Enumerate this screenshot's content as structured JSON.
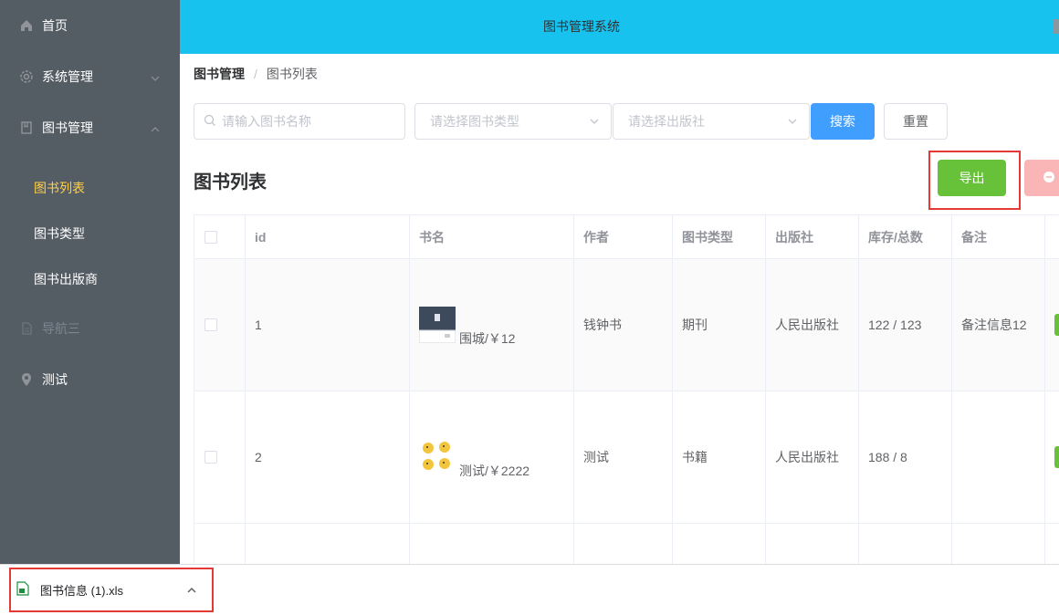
{
  "sidebar": {
    "home": "首页",
    "system": "系统管理",
    "books": "图书管理",
    "submenu": [
      "图书列表",
      "图书类型",
      "图书出版商"
    ],
    "nav3": "导航三",
    "test": "测试"
  },
  "header": {
    "title": "图书管理系统"
  },
  "breadcrumb": {
    "parent": "图书管理",
    "separator": "/",
    "current": "图书列表"
  },
  "filters": {
    "name_placeholder": "请输入图书名称",
    "type_placeholder": "请选择图书类型",
    "publisher_placeholder": "请选择出版社",
    "search_label": "搜索",
    "reset_label": "重置"
  },
  "section": {
    "title": "图书列表",
    "export_label": "导出"
  },
  "table": {
    "headers": [
      "id",
      "书名",
      "作者",
      "图书类型",
      "出版社",
      "库存/总数",
      "备注"
    ],
    "rows": [
      {
        "id": "1",
        "name": "围城/￥12",
        "author": "钱钟书",
        "type": "期刊",
        "publisher": "人民出版社",
        "stock": "122 / 123",
        "note": "备注信息12"
      },
      {
        "id": "2",
        "name": "测试/￥2222",
        "author": "测试",
        "type": "书籍",
        "publisher": "人民出版社",
        "stock": "188 / 8",
        "note": ""
      }
    ]
  },
  "download": {
    "filename": "图书信息 (1).xls"
  },
  "colors": {
    "sidebar": "#545c64",
    "header": "#17c2ee",
    "active": "#ffd04b",
    "primary": "#409eff",
    "success": "#67c23a",
    "highlight": "#e53935"
  },
  "icons": [
    "home-icon",
    "gear-icon",
    "book-icon",
    "document-icon",
    "location-icon",
    "search-icon",
    "chevron-down-icon",
    "chevron-up-icon",
    "xls-file-icon"
  ]
}
